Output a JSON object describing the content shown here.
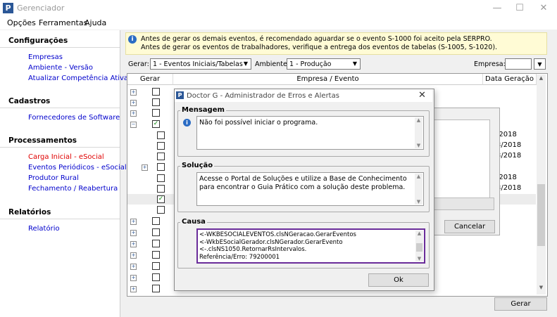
{
  "window": {
    "title": "Gerenciador",
    "minimize": "—",
    "maximize": "☐",
    "close": "✕"
  },
  "menu": [
    "Opções",
    "Ferramentas",
    "Ajuda"
  ],
  "sidebar": {
    "config": {
      "title": "Configurações",
      "items": [
        "Empresas",
        "Ambiente - Versão",
        "Atualizar Competência Ativa"
      ]
    },
    "cadastros": {
      "title": "Cadastros",
      "items": [
        "Fornecedores de Software"
      ]
    },
    "processamentos": {
      "title": "Processamentos",
      "items": [
        "Carga Inicial - eSocial",
        "Eventos Periódicos - eSocial",
        "Produtor Rural",
        "Fechamento / Reabertura"
      ]
    },
    "relatorios": {
      "title": "Relatórios",
      "items": [
        "Relatório"
      ]
    }
  },
  "info": {
    "line1": "Antes de gerar os demais eventos, é recomendado aguardar se o evento S-1000 foi aceito pela SERPRO.",
    "line2": "Antes de gerar os eventos de trabalhadores, verifique a entrega dos eventos de tabelas (S-1005, S-1020)."
  },
  "filters": {
    "gerar_label": "Gerar:",
    "gerar_value": "1 - Eventos Iniciais/Tabelas",
    "ambiente_label": "Ambiente:",
    "ambiente_value": "1 - Produção",
    "empresa_label": "Empresa:",
    "empresa_value": ""
  },
  "grid": {
    "headers": {
      "gerar": "Gerar",
      "empresa": "Empresa / Evento",
      "data": "Data Geração"
    },
    "dates": [
      "/2018",
      "3/2018",
      "3/2018",
      "/2018",
      "3/2018"
    ]
  },
  "buttons": {
    "gerar": "Gerar",
    "cancelar": "Cancelar",
    "ok": "Ok"
  },
  "dialog": {
    "title": "Doctor G - Administrador de Erros e Alertas",
    "mensagem_title": "Mensagem",
    "mensagem": "Não foi possível iniciar o programa.",
    "solucao_title": "Solução",
    "solucao": "Acesse o Portal de Soluções e utilize a Base de Conhecimento para encontrar o Guia Prático com a solução deste problema.",
    "causa_title": "Causa",
    "causa_lines": [
      "<-WKBESOCIALEVENTOS.clsNGeracao.GerarEventos",
      "<-WkbESocialGerador.clsNGerador.GerarEvento",
      "<-.clsNS1050.RetornarRsIntervalos.",
      "Referência/Erro: 79200001"
    ]
  },
  "colors": {
    "accent": "#2b5797",
    "link": "#0000cc",
    "active_link": "#e00000",
    "highlight_border": "#6a2c9a"
  }
}
